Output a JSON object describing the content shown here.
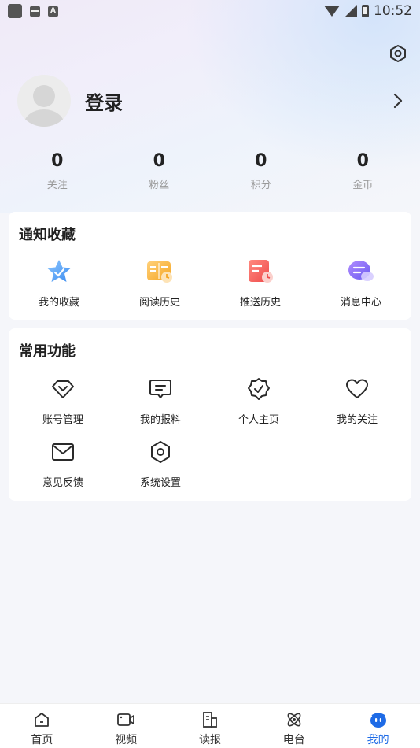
{
  "status_bar": {
    "time": "10:52",
    "icon_a": "A"
  },
  "profile": {
    "login_label": "登录"
  },
  "stats": [
    {
      "value": "0",
      "label": "关注"
    },
    {
      "value": "0",
      "label": "粉丝"
    },
    {
      "value": "0",
      "label": "积分"
    },
    {
      "value": "0",
      "label": "金币"
    }
  ],
  "notify_section": {
    "title": "通知收藏",
    "items": [
      {
        "label": "我的收藏",
        "icon": "star-icon"
      },
      {
        "label": "阅读历史",
        "icon": "book-history-icon"
      },
      {
        "label": "推送历史",
        "icon": "push-history-icon"
      },
      {
        "label": "消息中心",
        "icon": "message-center-icon"
      }
    ]
  },
  "common_section": {
    "title": "常用功能",
    "items": [
      {
        "label": "账号管理",
        "icon": "diamond-icon"
      },
      {
        "label": "我的报料",
        "icon": "chat-bubble-icon"
      },
      {
        "label": "个人主页",
        "icon": "verified-badge-icon"
      },
      {
        "label": "我的关注",
        "icon": "heart-icon"
      },
      {
        "label": "意见反馈",
        "icon": "mail-icon"
      },
      {
        "label": "系统设置",
        "icon": "gear-icon"
      }
    ]
  },
  "tabbar": [
    {
      "label": "首页",
      "icon": "home-icon",
      "active": false
    },
    {
      "label": "视频",
      "icon": "video-icon",
      "active": false
    },
    {
      "label": "读报",
      "icon": "newspaper-icon",
      "active": false
    },
    {
      "label": "电台",
      "icon": "radio-icon",
      "active": false
    },
    {
      "label": "我的",
      "icon": "profile-icon",
      "active": true
    }
  ],
  "colors": {
    "accent": "#1e6be6",
    "background": "#f5f6fa"
  }
}
